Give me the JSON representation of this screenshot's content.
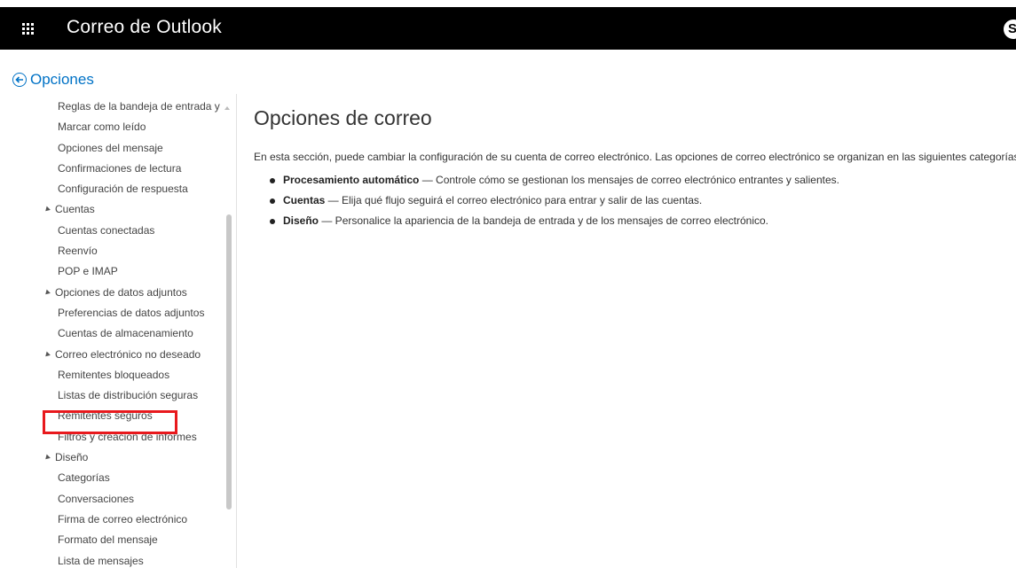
{
  "app": {
    "title": "Correo de Outlook",
    "skype_glyph": "S"
  },
  "back": {
    "label": "Opciones"
  },
  "sidebar": {
    "items": [
      {
        "label": "Reglas de la bandeja de entrada y",
        "kind": "child"
      },
      {
        "label": "Marcar como leído",
        "kind": "child"
      },
      {
        "label": "Opciones del mensaje",
        "kind": "child"
      },
      {
        "label": "Confirmaciones de lectura",
        "kind": "child"
      },
      {
        "label": "Configuración de respuesta",
        "kind": "child"
      },
      {
        "label": "Cuentas",
        "kind": "group"
      },
      {
        "label": "Cuentas conectadas",
        "kind": "child"
      },
      {
        "label": "Reenvío",
        "kind": "child"
      },
      {
        "label": "POP e IMAP",
        "kind": "child"
      },
      {
        "label": "Opciones de datos adjuntos",
        "kind": "group"
      },
      {
        "label": "Preferencias de datos adjuntos",
        "kind": "child"
      },
      {
        "label": "Cuentas de almacenamiento",
        "kind": "child"
      },
      {
        "label": "Correo electrónico no deseado",
        "kind": "group"
      },
      {
        "label": "Remitentes bloqueados",
        "kind": "child"
      },
      {
        "label": "Listas de distribución seguras",
        "kind": "child"
      },
      {
        "label": "Remitentes seguros",
        "kind": "child",
        "highlighted": true
      },
      {
        "label": "Filtros y creación de informes",
        "kind": "child"
      },
      {
        "label": "Diseño",
        "kind": "group"
      },
      {
        "label": "Categorías",
        "kind": "child"
      },
      {
        "label": "Conversaciones",
        "kind": "child"
      },
      {
        "label": "Firma de correo electrónico",
        "kind": "child"
      },
      {
        "label": "Formato del mensaje",
        "kind": "child"
      },
      {
        "label": "Lista de mensajes",
        "kind": "child"
      }
    ]
  },
  "main": {
    "title": "Opciones de correo",
    "intro": "En esta sección, puede cambiar la configuración de su cuenta de correo electrónico. Las opciones de correo electrónico se organizan en las siguientes categorías",
    "bullets": [
      {
        "term": "Procesamiento automático",
        "desc": " — Controle cómo se gestionan los mensajes de correo electrónico entrantes y salientes."
      },
      {
        "term": "Cuentas",
        "desc": " — Elija qué flujo seguirá el correo electrónico para entrar y salir de las cuentas."
      },
      {
        "term": "Diseño",
        "desc": " — Personalice la apariencia de la bandeja de entrada y de los mensajes de correo electrónico."
      }
    ]
  },
  "colors": {
    "topbar": "#000000",
    "link": "#0072c6",
    "highlight": "#e8191d"
  },
  "icons": {
    "waffle": "app-launcher-icon",
    "back": "back-arrow-circle-icon",
    "collapse": "collapse-triangle-icon",
    "skype": "skype-icon"
  }
}
